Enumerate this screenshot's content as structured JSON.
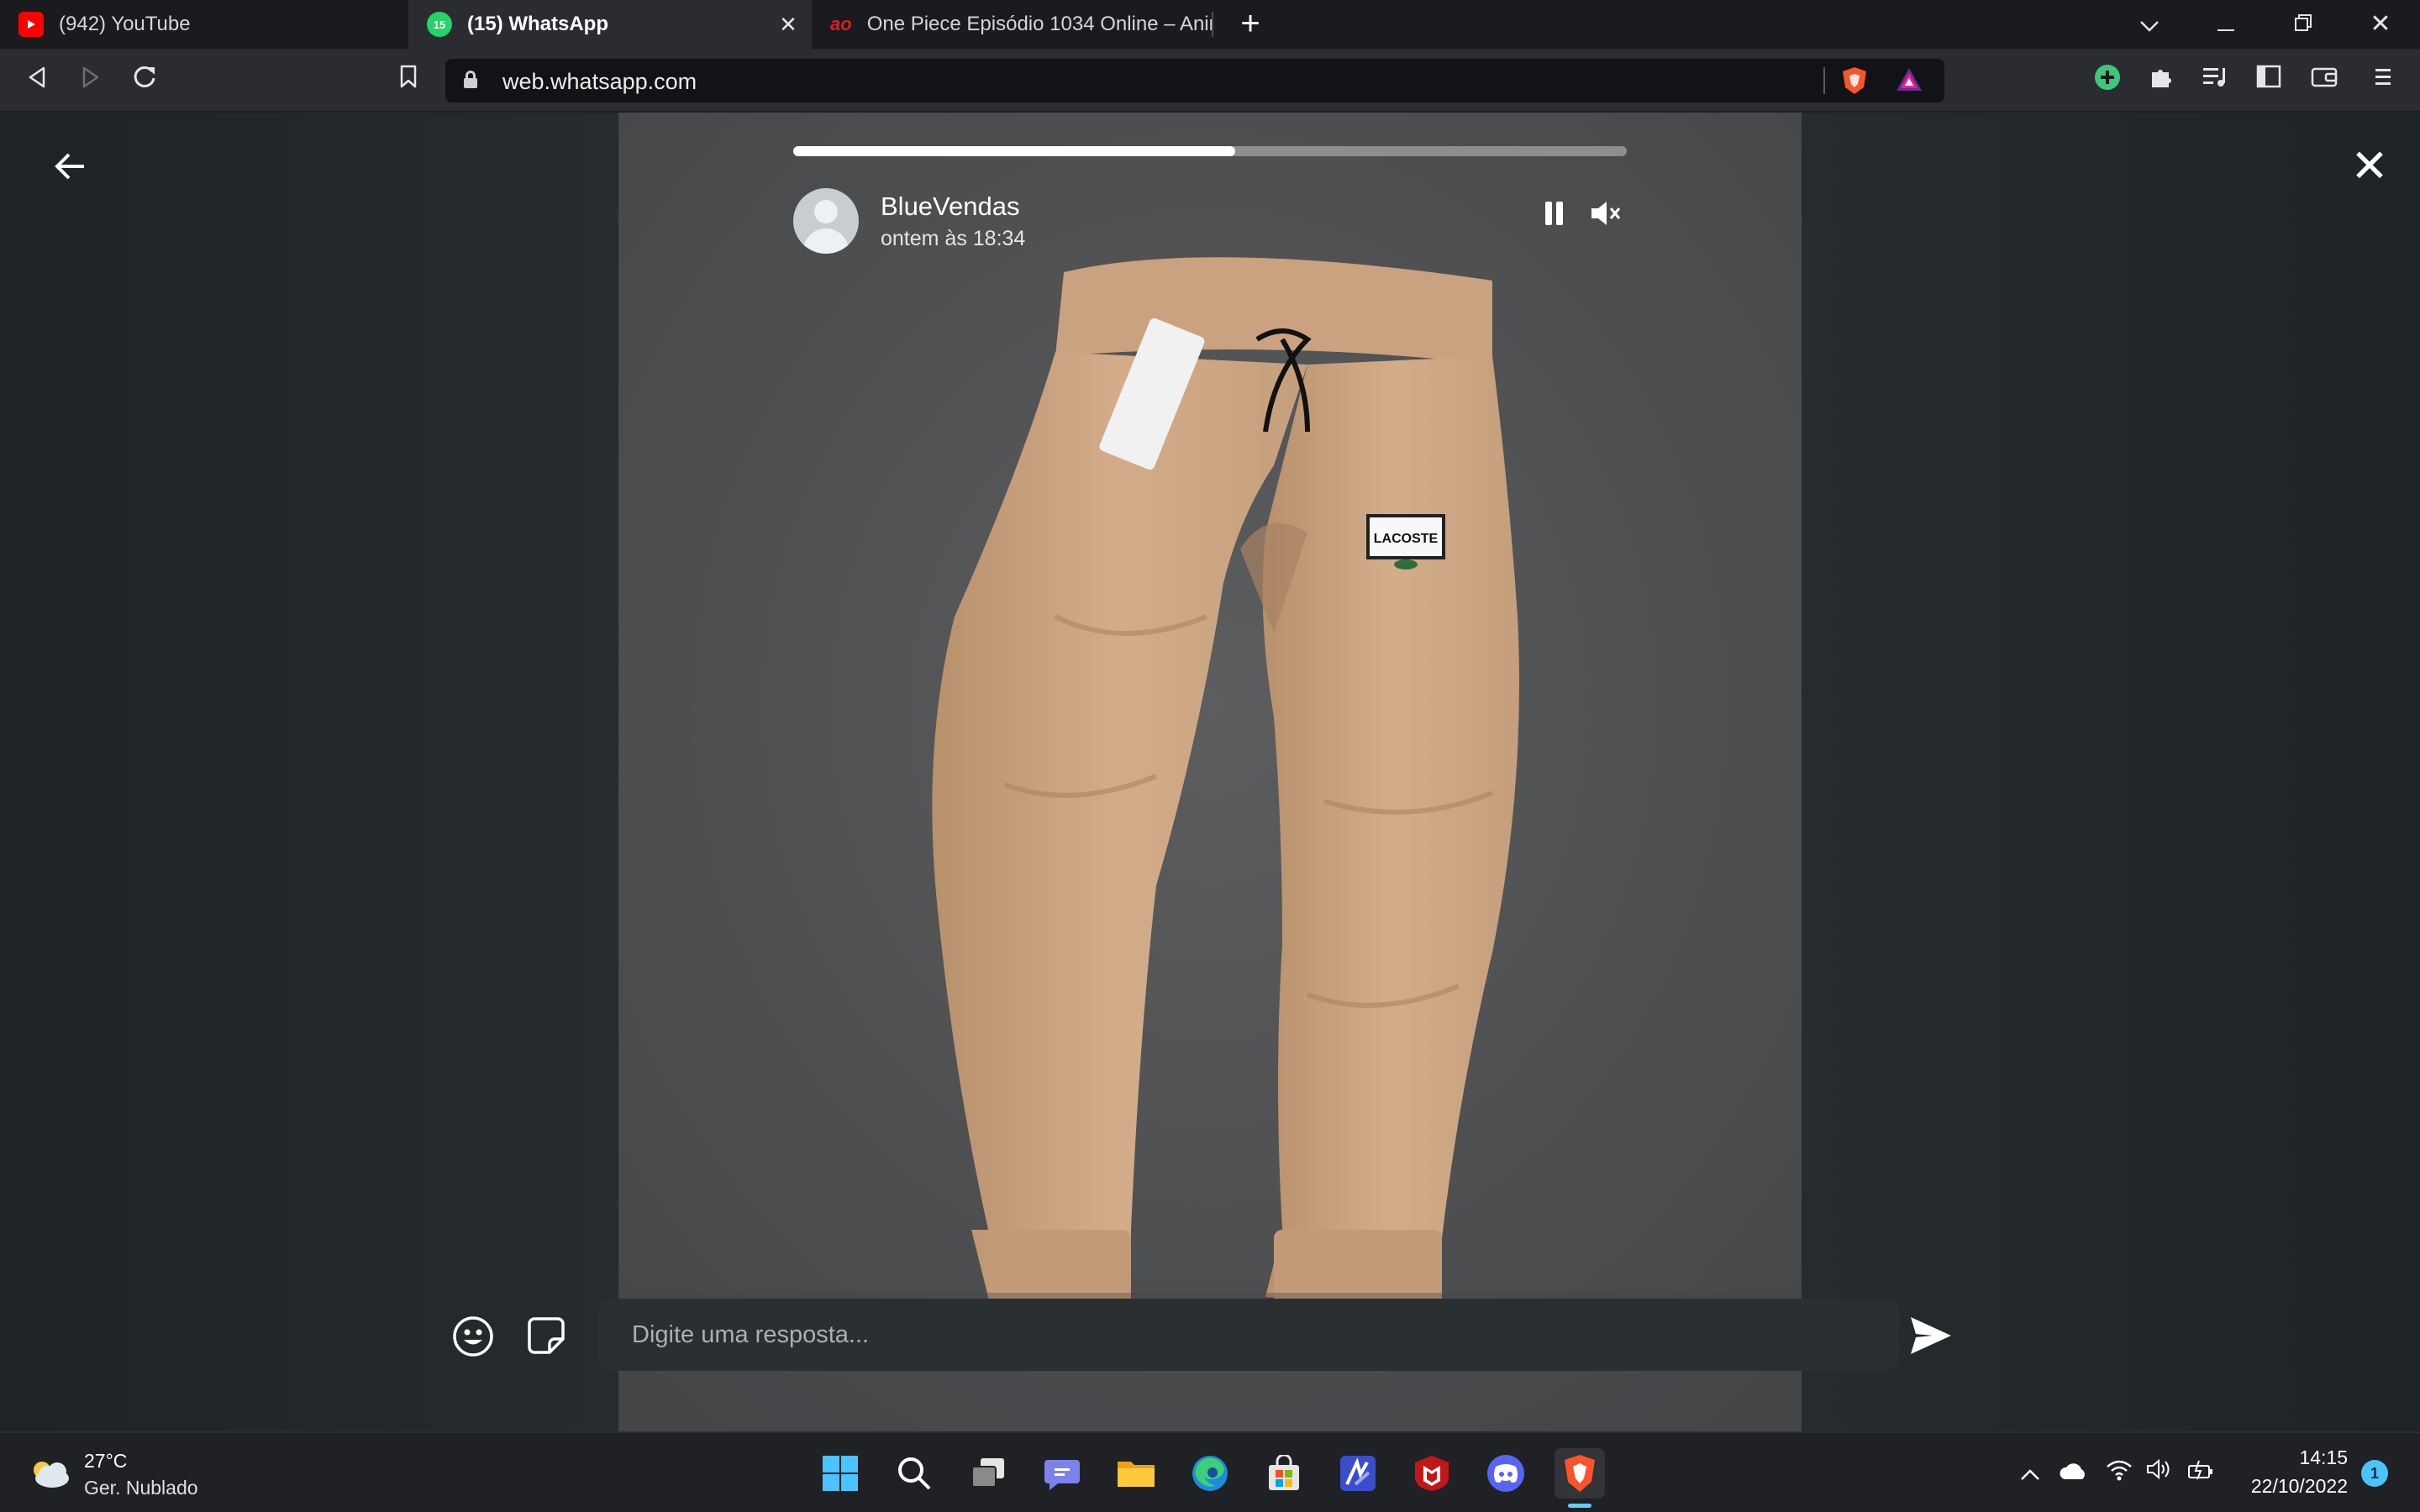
{
  "browser": {
    "tabs": [
      {
        "title": "(942) YouTube",
        "favicon_color": "#ff0000"
      },
      {
        "title": "(15) WhatsApp",
        "favicon_color": "#25d366",
        "badge": "15"
      },
      {
        "title": "One Piece Episódio 1034 Online – Anir",
        "favicon_text": "ao",
        "favicon_color": "#d81e28"
      }
    ],
    "active_tab_index": 1,
    "url": "web.whatsapp.com",
    "accent": "#fb542b"
  },
  "status": {
    "contact_name": "BlueVendas",
    "timestamp": "ontem às 18:34",
    "progress": 0.53,
    "reply_placeholder": "Digite uma resposta..."
  },
  "taskbar": {
    "weather_temp": "27°C",
    "weather_desc": "Ger. Nublado",
    "time": "14:15",
    "date": "22/10/2022",
    "notification_count": "1",
    "apps": [
      "windows-start",
      "search",
      "task-view",
      "teams-chat",
      "file-explorer",
      "edge",
      "microsoft-store",
      "media-app",
      "mcafee",
      "discord",
      "brave"
    ]
  }
}
